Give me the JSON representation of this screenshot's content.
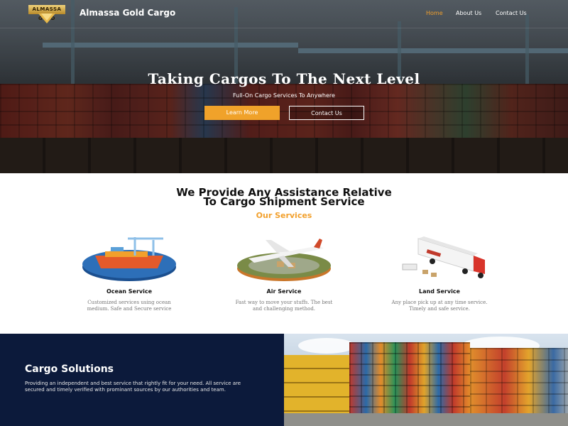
{
  "nav": {
    "logo_text": "ALMASSA GOLD",
    "brand": "Almassa Gold Cargo",
    "links": [
      {
        "label": "Home",
        "active": true
      },
      {
        "label": "About Us",
        "active": false
      },
      {
        "label": "Contact Us",
        "active": false
      }
    ]
  },
  "hero": {
    "title": "Taking Cargos To The Next Level",
    "subtitle": "Full-On Cargo Services To Anywhere",
    "primary_button": "Learn More",
    "secondary_button": "Contact Us"
  },
  "services": {
    "heading_line1": "We Provide Any Assistance Relative",
    "heading_line2": "To Cargo Shipment Service",
    "tagline": "Our Services",
    "items": [
      {
        "title": "Ocean Service",
        "desc_line1": "Customized services using ocean",
        "desc_line2": "medium. Safe and Secure service",
        "icon": "ship-crane-icon"
      },
      {
        "title": "Air Service",
        "desc_line1": "Fast way to move your stuffs. The best",
        "desc_line2": "and challenging method.",
        "icon": "airplane-icon"
      },
      {
        "title": "Land Service",
        "desc_line1": "Any place pick up at any time service.",
        "desc_line2": "Timely and safe service.",
        "icon": "truck-icon"
      }
    ]
  },
  "solutions": {
    "title": "Cargo Solutions",
    "text": "Providing an independent and best service that rightly fit for your need. All service are secured and timely verified with prominant sources by our authorities and team."
  },
  "colors": {
    "accent": "#f2a02c",
    "navy": "#0c1a3b"
  }
}
